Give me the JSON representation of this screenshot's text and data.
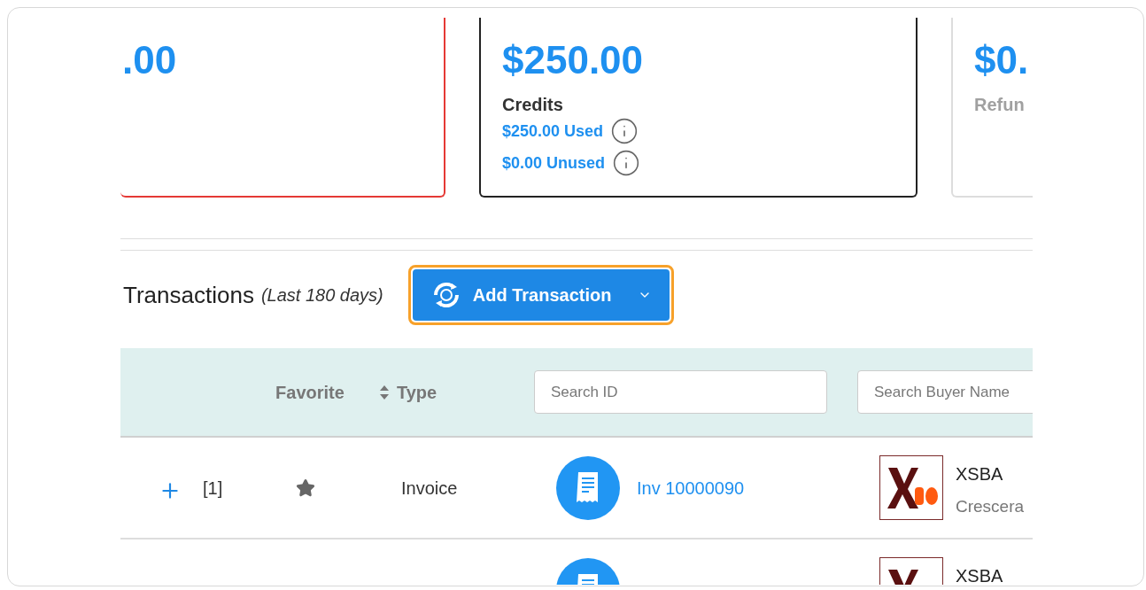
{
  "summary_cards": [
    {
      "amount": ".00",
      "color": "#e53935"
    },
    {
      "amount": "$250.00",
      "color": "#222222",
      "label": "Credits",
      "muted": false,
      "details": [
        "$250.00 Used",
        "$0.00 Unused"
      ]
    },
    {
      "amount": "$0.",
      "color": "#dddddd",
      "label": "Refun",
      "muted": true
    }
  ],
  "transactions": {
    "title": "Transactions",
    "subtitle": "(Last 180 days)",
    "add_button": "Add Transaction"
  },
  "table": {
    "columns": [
      {
        "label": "Favorite",
        "sortable": false
      },
      {
        "label": "Type",
        "sortable": true
      }
    ],
    "search_fields": [
      {
        "placeholder": "Search ID"
      },
      {
        "placeholder": "Search Buyer Name"
      }
    ],
    "rows": [
      {
        "index": "[1]",
        "favorite": true,
        "type": "Invoice",
        "id": "Inv 10000090",
        "buyer": "XSBA",
        "buyer_sub": "Crescera"
      },
      {
        "buyer": "XSBA"
      }
    ]
  }
}
